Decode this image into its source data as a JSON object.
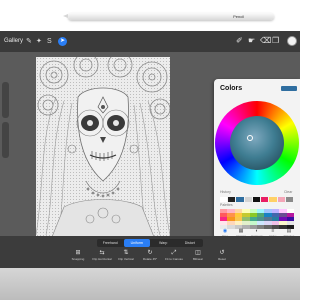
{
  "pencil": {
    "brand": "Pencil"
  },
  "toolbar": {
    "gallery_label": "Gallery",
    "left_tools": [
      {
        "icon": "wrench-icon",
        "glyph": "✎"
      },
      {
        "icon": "magic-wand-icon",
        "glyph": "✦"
      },
      {
        "icon": "selection-icon",
        "glyph": "S"
      },
      {
        "icon": "transform-arrow-icon",
        "glyph": "➤"
      }
    ],
    "right_tools": [
      {
        "icon": "brush-icon",
        "glyph": "✐"
      },
      {
        "icon": "smudge-icon",
        "glyph": "☛"
      },
      {
        "icon": "eraser-icon",
        "glyph": "⌫"
      },
      {
        "icon": "layers-icon",
        "glyph": "❐"
      }
    ]
  },
  "colors_panel": {
    "title": "Colors",
    "history_label": "History",
    "clear_label": "Clear",
    "palettes_label": "Palettes",
    "history_colors": [
      "#ffffff",
      "#222222",
      "#2f6ea0",
      "#d4d4d4",
      "#111111",
      "#e91e63",
      "#ffd166",
      "#f4a6b8",
      "#8a8a8a"
    ],
    "palette_colors": [
      "#ff9aa2",
      "#ffb3c6",
      "#ffd6a5",
      "#fdffb6",
      "#caffbf",
      "#9bf6ff",
      "#a0c4ff",
      "#bdb2ff",
      "#ffc6ff",
      "#fffffc",
      "#ff595e",
      "#ff924c",
      "#ffca3a",
      "#c5ca30",
      "#8ac926",
      "#52a675",
      "#1982c4",
      "#4267ac",
      "#6a4c93",
      "#b5179e",
      "#f72585",
      "#f8961e",
      "#f9c74f",
      "#90be6d",
      "#43aa8b",
      "#4d908e",
      "#577590",
      "#277da1",
      "#7209b7",
      "#3a0ca3",
      "#ffe5ec",
      "#ffd7ba",
      "#fff1c1",
      "#e2f0cb",
      "#c7f9cc",
      "#cde7ff",
      "#dcd6f7",
      "#f1c0e8",
      "#fbf8cc",
      "#e4e4e4",
      "#eaeaea",
      "#dadada",
      "#c8c8c8",
      "#b0b0b0",
      "#9a9a9a",
      "#808080",
      "#666666",
      "#4d4d4d",
      "#333333",
      "#1a1a1a"
    ],
    "tabs": [
      {
        "icon": "disc-icon",
        "label": "Disc",
        "glyph": "◉",
        "active": true
      },
      {
        "icon": "classic-icon",
        "label": "Classic",
        "glyph": "▦",
        "active": false
      },
      {
        "icon": "harmony-icon",
        "label": "Harmony",
        "glyph": "◐",
        "active": false
      },
      {
        "icon": "value-icon",
        "label": "Value",
        "glyph": "≡",
        "active": false
      },
      {
        "icon": "palettes-icon",
        "label": "Palettes",
        "glyph": "▤",
        "active": false
      }
    ]
  },
  "mode_tabs": [
    {
      "label": "Freehand",
      "active": false
    },
    {
      "label": "Uniform",
      "active": true
    },
    {
      "label": "Warp",
      "active": false
    },
    {
      "label": "Distort",
      "active": false
    }
  ],
  "actions": [
    {
      "icon": "snapping-icon",
      "label": "Snapping",
      "glyph": "⊞"
    },
    {
      "icon": "flip-horizontal-icon",
      "label": "Flip Horizontal",
      "glyph": "⇆"
    },
    {
      "icon": "flip-vertical-icon",
      "label": "Flip Vertical",
      "glyph": "⇅"
    },
    {
      "icon": "rotate-icon",
      "label": "Rotate 45°",
      "glyph": "↻"
    },
    {
      "icon": "fit-to-canvas-icon",
      "label": "Fit to Canvas",
      "glyph": "⤢"
    },
    {
      "icon": "interpolation-icon",
      "label": "Bilinear",
      "glyph": "◫"
    },
    {
      "icon": "reset-icon",
      "label": "Reset",
      "glyph": "↺"
    }
  ]
}
